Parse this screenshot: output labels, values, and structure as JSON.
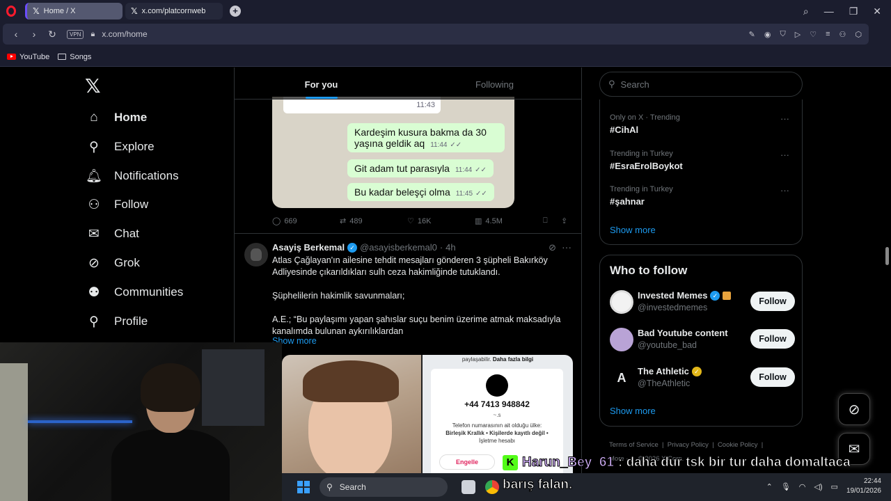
{
  "browser": {
    "tabs": [
      {
        "label": "Home / X",
        "active": true
      },
      {
        "label": "x.com/platcornweb",
        "active": false
      }
    ],
    "vpn_label": "VPN",
    "url": "x.com/home",
    "ai_label": "AI",
    "bookmarks": [
      {
        "label": "YouTube",
        "icon": "youtube-icon"
      },
      {
        "label": "Songs",
        "icon": "folder-icon"
      }
    ]
  },
  "nav": {
    "items": [
      {
        "label": "Home",
        "icon": "home-icon",
        "active": true
      },
      {
        "label": "Explore",
        "icon": "search-icon"
      },
      {
        "label": "Notifications",
        "icon": "bell-icon"
      },
      {
        "label": "Follow",
        "icon": "add-person-icon"
      },
      {
        "label": "Chat",
        "icon": "mail-icon"
      },
      {
        "label": "Grok",
        "icon": "grok-icon"
      },
      {
        "label": "Communities",
        "icon": "communities-icon"
      },
      {
        "label": "Profile",
        "icon": "person-icon"
      }
    ]
  },
  "feed": {
    "tabs": [
      {
        "label": "For you",
        "active": true
      },
      {
        "label": "Following",
        "active": false
      }
    ],
    "chat_image": {
      "top_time": "11:43",
      "bubbles": [
        {
          "text": "Kardeşim kusura bakma da 30 yaşına geldik aq",
          "time": "11:44"
        },
        {
          "text": "Git adam tut parasıyla",
          "time": "11:44"
        },
        {
          "text": "Bu kadar beleşçi olma",
          "time": "11:45"
        }
      ]
    },
    "post1_stats": {
      "replies": "669",
      "reposts": "489",
      "likes": "16K",
      "views": "4.5M"
    },
    "post2": {
      "name": "Asayiş Berkemal",
      "handle": "@asayisberkemal0",
      "time": "4h",
      "paragraphs": [
        "Atlas Çağlayan'ın ailesine tehdit mesajları gönderen 3 şüpheli Bakırköy Adliyesinde çıkarıldıkları sulh ceza hakimliğinde tutuklandı.",
        "Şüphelilerin hakimlik savunmaları;",
        "A.E.; “Bu paylaşımı yapan şahıslar suçu benim üzerime atmak maksadıyla kanalımda bulunan aykırılıklardan"
      ],
      "show_more": "Show more",
      "media_right": {
        "top_text": "paylaşabilir.",
        "top_link": "Daha fazla bilgi",
        "phone": "+44 7413 948842",
        "sub": "~.s",
        "country_line1": "Telefon numarasının ait olduğu ülke:",
        "country_line2": "Birleşik Krallık • Kişilerde kayıtlı değil •",
        "country_line3": "İşletme hesabı",
        "button": "Engelle"
      }
    }
  },
  "sidebar": {
    "search_placeholder": "Search",
    "trends": [
      {
        "meta": "Only on X · Trending",
        "tag": "#CihAl"
      },
      {
        "meta": "Trending in Turkey",
        "tag": "#EsraErolBoykot"
      },
      {
        "meta": "Trending in Turkey",
        "tag": "#şahnar"
      }
    ],
    "trends_show_more": "Show more",
    "who_to_follow": {
      "title": "Who to follow",
      "accounts": [
        {
          "name": "Invested Memes",
          "handle": "@investedmemes",
          "button": "Follow"
        },
        {
          "name": "Bad Youtube content",
          "handle": "@youtube_bad",
          "button": "Follow"
        },
        {
          "name": "The Athletic",
          "handle": "@TheAthletic",
          "button": "Follow"
        }
      ],
      "show_more": "Show more"
    },
    "footer": [
      "Terms of Service",
      "Privacy Policy",
      "Cookie Policy",
      "More ···",
      "© 2026 X Corp."
    ]
  },
  "taskbar": {
    "search_label": "Search",
    "time": "22:44",
    "date": "19/01/2026"
  },
  "stream_chat": {
    "username": "Harun_Bey_61",
    "message": ": daha dur tsk bir tur daha domaltaca",
    "continuation": "barış falan."
  },
  "colors": {
    "accent": "#1d9bf0",
    "background": "#000000",
    "chrome": "#1b1d2e",
    "kick_green": "#53fc18"
  }
}
